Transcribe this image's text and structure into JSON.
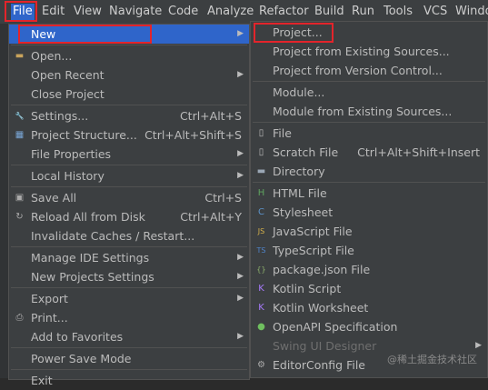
{
  "menubar": [
    "File",
    "Edit",
    "View",
    "Navigate",
    "Code",
    "Analyze",
    "Refactor",
    "Build",
    "Run",
    "Tools",
    "VCS",
    "Windo"
  ],
  "file_menu": [
    {
      "label": "New",
      "arrow": true,
      "selected": true
    },
    {
      "sep": true
    },
    {
      "label": "Open...",
      "icon": "folder-icon"
    },
    {
      "label": "Open Recent",
      "arrow": true
    },
    {
      "label": "Close Project"
    },
    {
      "sep": true
    },
    {
      "label": "Settings...",
      "shortcut": "Ctrl+Alt+S",
      "icon": "wrench-icon"
    },
    {
      "label": "Project Structure...",
      "shortcut": "Ctrl+Alt+Shift+S",
      "icon": "project-structure-icon"
    },
    {
      "label": "File Properties",
      "arrow": true
    },
    {
      "sep": true
    },
    {
      "label": "Local History",
      "arrow": true
    },
    {
      "sep": true
    },
    {
      "label": "Save All",
      "shortcut": "Ctrl+S",
      "icon": "save-icon"
    },
    {
      "label": "Reload All from Disk",
      "shortcut": "Ctrl+Alt+Y",
      "icon": "reload-icon"
    },
    {
      "label": "Invalidate Caches / Restart..."
    },
    {
      "sep": true
    },
    {
      "label": "Manage IDE Settings",
      "arrow": true
    },
    {
      "label": "New Projects Settings",
      "arrow": true
    },
    {
      "sep": true
    },
    {
      "label": "Export",
      "arrow": true
    },
    {
      "label": "Print...",
      "icon": "print-icon"
    },
    {
      "label": "Add to Favorites",
      "arrow": true
    },
    {
      "sep": true
    },
    {
      "label": "Power Save Mode"
    },
    {
      "sep": true
    },
    {
      "label": "Exit"
    }
  ],
  "new_menu": [
    {
      "label": "Project..."
    },
    {
      "label": "Project from Existing Sources..."
    },
    {
      "label": "Project from Version Control..."
    },
    {
      "sep": true
    },
    {
      "label": "Module..."
    },
    {
      "label": "Module from Existing Sources..."
    },
    {
      "sep": true
    },
    {
      "label": "File",
      "icon": "file-icon"
    },
    {
      "label": "Scratch File",
      "shortcut": "Ctrl+Alt+Shift+Insert",
      "icon": "scratch-file-icon"
    },
    {
      "label": "Directory",
      "icon": "directory-icon"
    },
    {
      "sep": true
    },
    {
      "label": "HTML File",
      "icon": "html-file-icon"
    },
    {
      "label": "Stylesheet",
      "icon": "css-file-icon"
    },
    {
      "label": "JavaScript File",
      "icon": "js-file-icon"
    },
    {
      "label": "TypeScript File",
      "icon": "ts-file-icon"
    },
    {
      "label": "package.json File",
      "icon": "package-json-icon"
    },
    {
      "label": "Kotlin Script",
      "icon": "kotlin-script-icon"
    },
    {
      "label": "Kotlin Worksheet",
      "icon": "kotlin-worksheet-icon"
    },
    {
      "label": "OpenAPI Specification",
      "icon": "openapi-icon"
    },
    {
      "label": "Swing UI Designer",
      "arrow": true,
      "disabled": true
    },
    {
      "label": "EditorConfig File",
      "icon": "editorconfig-icon"
    }
  ],
  "watermark": "@稀土掘金技术社区",
  "colors": {
    "menubar": "#3c3f41",
    "selection": "#2f65ca",
    "highlight_box": "#e3242b"
  }
}
